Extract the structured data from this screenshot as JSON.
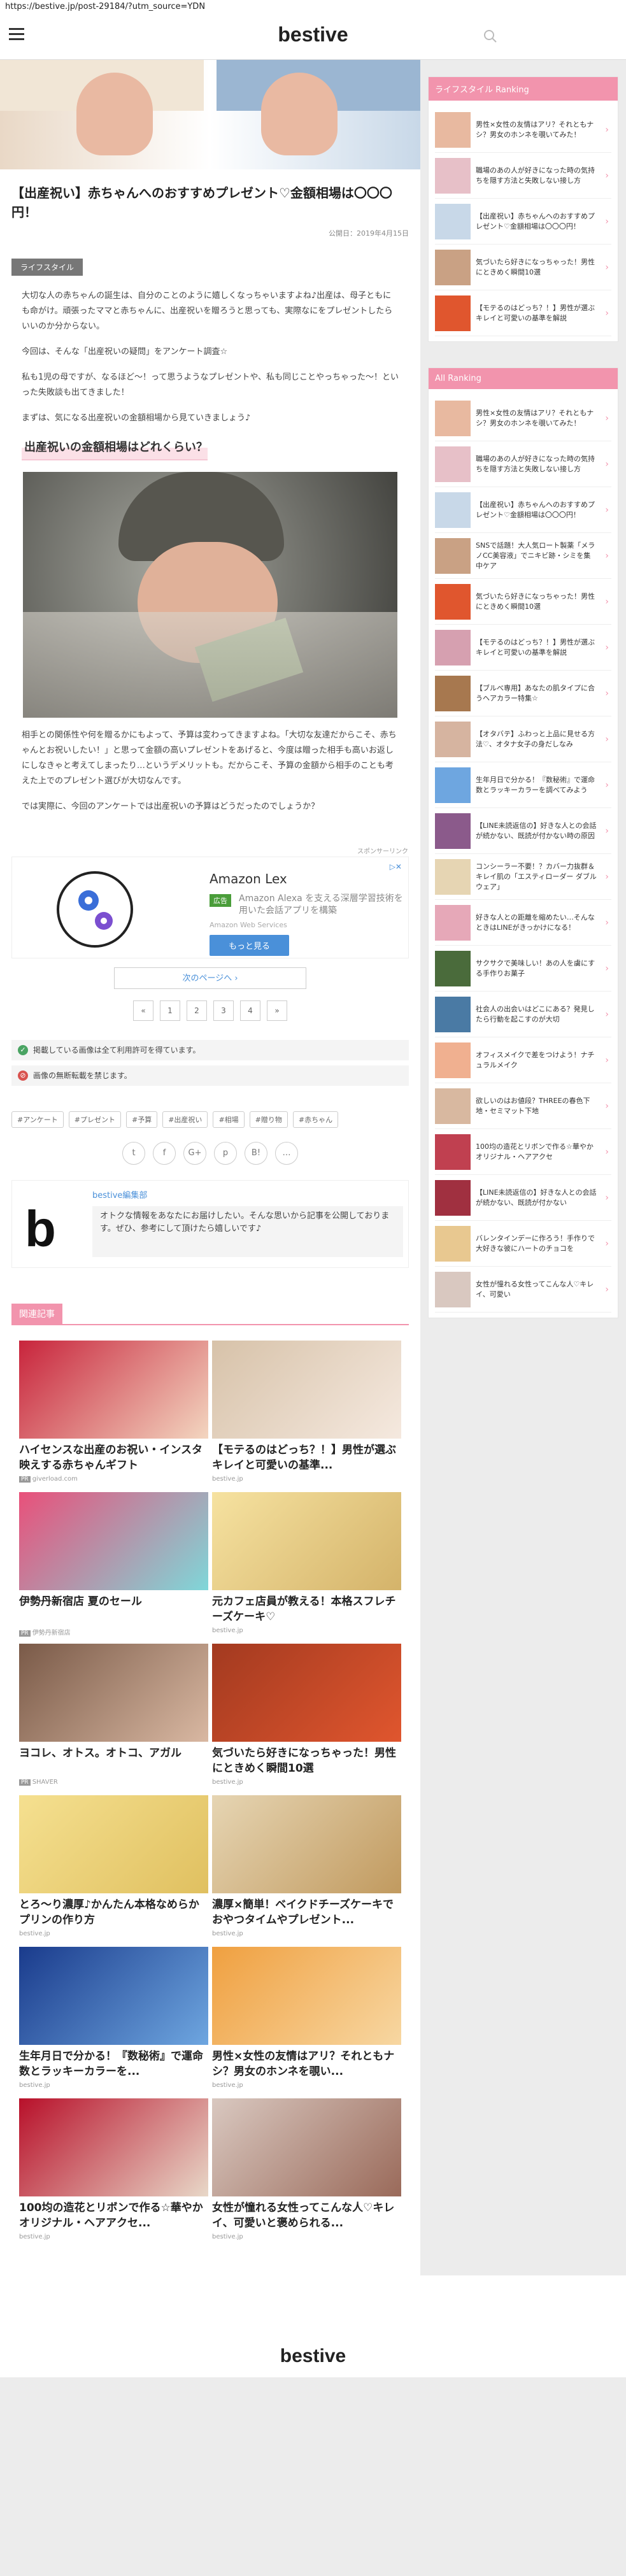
{
  "url": "https://bestive.jp/post-29184/?utm_source=YDN",
  "site": {
    "logo": "bestive"
  },
  "article": {
    "title": "【出産祝い】赤ちゃんへのおすすめプレゼント♡金額相場は〇〇〇円！",
    "date": "公開日：2019年4月15日",
    "category": "ライフスタイル",
    "intro": [
      "大切な人の赤ちゃんの誕生は、自分のことのように嬉しくなっちゃいますよね♪出産は、母子ともにも命がけ。頑張ったママと赤ちゃんに、出産祝いを贈ろうと思っても、実際なにをプレゼントしたらいいのか分からない。",
      "今回は、そんな「出産祝いの疑問」をアンケート調査☆",
      "私も1児の母ですが、なるほど～！って思うようなプレゼントや、私も同じことやっちゃった～！といった失敗談も出てきました！",
      "まずは、気になる出産祝いの金額相場から見ていきましょう♪"
    ],
    "heading": "出産祝いの金額相場はどれくらい？",
    "body": [
      "相手との関係性や何を贈るかにもよって、予算は変わってきますよね。「大切な友達だからこそ、赤ちゃんとお祝いしたい！」と思って金額の高いプレゼントをあげると、今度は贈った相手も高いお返しにしなきゃと考えてしまったり…というデメリットも。だからこそ、予算の金額から相手のことも考えた上でのプレゼント選びが大切なんです。",
      "では実際に、今回のアンケートでは出産祝いの予算はどうだったのでしょうか？"
    ]
  },
  "ad": {
    "label": "スポンサーリンク",
    "title": "Amazon Lex",
    "badge": "広告",
    "desc": "Amazon Alexa を支える深層学習技術を用いた会話アプリを構築",
    "sub": "Amazon Web Services",
    "button": "もっと見る",
    "close": "▷✕"
  },
  "next_page": "次のページへ ›",
  "pager": [
    "«",
    "1",
    "2",
    "3",
    "4",
    "»"
  ],
  "notices": [
    {
      "text": "掲載している画像は全て利用許可を得ています。",
      "color": "#4aa463",
      "icon": "✓"
    },
    {
      "text": "画像の無断転載を禁じます。",
      "color": "#d9534f",
      "icon": "⊘"
    }
  ],
  "tags": [
    "#アンケート",
    "#プレゼント",
    "#予算",
    "#出産祝い",
    "#相場",
    "#贈り物",
    "#赤ちゃん"
  ],
  "share": [
    "t",
    "f",
    "G+",
    "p",
    "B!",
    "…"
  ],
  "author": {
    "avatar": "b",
    "name": "bestive編集部",
    "bio": "オトクな情報をあなたにお届けしたい。そんな思いから記事を公開しております。ぜひ、参考にして頂けたら嬉しいです♪"
  },
  "related": {
    "heading": "関連記事",
    "items": [
      {
        "title": "ハイセンスな出産のお祝い・インスタ映えする赤ちゃんギフト",
        "src": "giverload.com",
        "pr": true
      },
      {
        "title": "【モテるのはどっち？！】男性が選ぶキレイと可愛いの基準...",
        "src": "bestive.jp",
        "pr": false
      },
      {
        "title": "伊勢丹新宿店 夏のセール",
        "src": "伊勢丹新宿店",
        "pr": true
      },
      {
        "title": "元カフェ店員が教える！本格スフレチーズケーキ♡",
        "src": "bestive.jp",
        "pr": false
      },
      {
        "title": "ヨコレ、オトス。オトコ、アガル",
        "src": "SHAVER",
        "pr": true
      },
      {
        "title": "気づいたら好きになっちゃった！男性にときめく瞬間10選",
        "src": "bestive.jp",
        "pr": false
      },
      {
        "title": "とろ～り濃厚♪かんたん本格なめらかプリンの作り方",
        "src": "bestive.jp",
        "pr": false
      },
      {
        "title": "濃厚×簡単！ベイクドチーズケーキでおやつタイムやプレゼント...",
        "src": "bestive.jp",
        "pr": false
      },
      {
        "title": "生年月日で分かる！『数秘術』で運命数とラッキーカラーを...",
        "src": "bestive.jp",
        "pr": false
      },
      {
        "title": "男性×女性の友情はアリ？それともナシ？男女のホンネを覗い...",
        "src": "bestive.jp",
        "pr": false
      },
      {
        "title": "100均の造花とリボンで作る☆華やかオリジナル・ヘアアクセ...",
        "src": "bestive.jp",
        "pr": false
      },
      {
        "title": "女性が憧れる女性ってこんな人♡キレイ、可愛いと褒められる...",
        "src": "bestive.jp",
        "pr": false
      }
    ]
  },
  "sidebar": {
    "lifestyle_ranking": {
      "heading": "ライフスタイル Ranking",
      "items": [
        "男性×女性の友情はアリ？それともナシ？男女のホンネを覗いてみた！",
        "職場のあの人が好きになった時の気持ちを隠す方法と失敗しない接し方",
        "【出産祝い】赤ちゃんへのおすすめプレゼント♡金額相場は〇〇〇円！",
        "気づいたら好きになっちゃった！男性にときめく瞬間10選",
        "【モテるのはどっち？！】男性が選ぶキレイと可愛いの基準を解説"
      ]
    },
    "all_ranking": {
      "heading": "All Ranking",
      "items": [
        "男性×女性の友情はアリ？それともナシ？男女のホンネを覗いてみた！",
        "職場のあの人が好きになった時の気持ちを隠す方法と失敗しない接し方",
        "【出産祝い】赤ちゃんへのおすすめプレゼント♡金額相場は〇〇〇円！",
        "SNSで話題！大人気ロート製薬「メラノCC美容液」でニキビ跡・シミを集中ケア",
        "気づいたら好きになっちゃった！男性にときめく瞬間10選",
        "【モテるのはどっち？！】男性が選ぶキレイと可愛いの基準を解説",
        "【ブルべ専用】あなたの肌タイプに合うヘアカラー特集☆",
        "【オタバテ】ふわっと上品に見せる方法♡、オタナ女子の身だしなみ",
        "生年月日で分かる！『数秘術』で運命数とラッキーカラーを調べてみよう",
        "【LINE未読返信の】好きな人との会話が続かない、既読が付かない時の原因",
        "コンシーラー不要！？カバー力抜群＆キレイ肌の「エスティローダー ダブルウェア」",
        "好きな人との距離を縮めたい…そんなときはLINEがきっかけになる！",
        "サクサクで美味しい！あの人を虜にする手作りお菓子",
        "社会人の出会いはどこにある？発見したら行動を起こすのが大切",
        "オフィスメイクで差をつけよう！ナチュラルメイク",
        "欲しいのはお値段？THREEの春色下地・セミマット下地",
        "100均の造花とリボンで作る☆華やかオリジナル・ヘアアクセ",
        "【LINE未読返信の】好きな人との会話が続かない、既読が付かない",
        "バレンタインデーに作ろう！手作りで大好きな彼にハートのチョコを",
        "女性が憧れる女性ってこんな人♡キレイ、可愛い"
      ]
    }
  },
  "footer": {
    "logo": "bestive"
  }
}
